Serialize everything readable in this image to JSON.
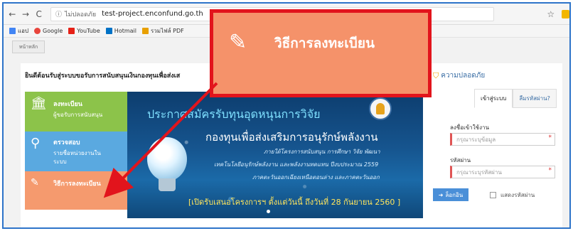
{
  "browser": {
    "insecure_label": "ไม่ปลอดภัย",
    "url": "test-project.enconfund.go.th",
    "bookmarks": [
      {
        "label": "แอป",
        "icon": "apps-grid-icon",
        "color": "#4285f4"
      },
      {
        "label": "Google",
        "icon": "google-icon",
        "color": "#e8453c"
      },
      {
        "label": "YouTube",
        "icon": "youtube-icon",
        "color": "#e62117"
      },
      {
        "label": "Hotmail",
        "icon": "hotmail-icon",
        "color": "#0072c6"
      },
      {
        "label": "รวมไฟล์ PDF",
        "icon": "pdf-merge-icon",
        "color": "#e8a000"
      }
    ]
  },
  "breadcrumb": "หน้าหลัก",
  "welcome": "ยินดีต้อนรับสู่ระบบขอรับการสนับสนุนเงินกองทุนเพื่อส่งเส",
  "security_label": "ความปลอดภัย",
  "menu": [
    {
      "title": "ลงทะเบียน",
      "subtitle": "ผู้ขอรับการสนับสนุน",
      "icon": "bank-icon"
    },
    {
      "title": "ตรวจสอบ",
      "subtitle": "รายชื่อหน่วยงานใน",
      "subtitle2": "ระบบ",
      "icon": "search-icon"
    },
    {
      "title": "วิธีการลงทะเบียน",
      "icon": "edit-icon"
    }
  ],
  "banner": {
    "headline": "ประกาศสมัครรับทุนอุดหนุนการวิจัย",
    "title": "กองทุนเพื่อส่งเสริมการอนุรักษ์พลังงาน",
    "line1": "ภายใต้โครงการสนับสนุน การศึกษา วิจัย พัฒนา",
    "line2": "เทคโนโลยีอนุรักษ์พลังงาน และพลังงานทดแทน ปีงบประมาณ 2559",
    "line3": "ภาคตะวันออกเฉียงเหนือตอนล่าง และภาคตะวันออก",
    "footer": "[เปิดรับเสนอโครงการฯ ตั้งแต่วันนี้ ถึงวันที่ 28 กันยายน 2560 ]"
  },
  "login": {
    "tab_login": "เข้าสู่ระบบ",
    "tab_forgot": "ลืมรหัสผ่าน?",
    "username_label": "ลงชื่อเข้าใช้งาน",
    "username_placeholder": "กรุณาระบุข้อมูล",
    "password_label": "รหัสผ่าน",
    "password_placeholder": "กรุณาระบุรหัสผ่าน",
    "login_button": "ล็อกอิน",
    "show_password": "แสดงรหัสผ่าน"
  },
  "callout": {
    "text": "วิธีการลงทะเบียน",
    "icon": "edit-icon",
    "border_color": "#e2141c",
    "fill_color": "#f5926a"
  }
}
